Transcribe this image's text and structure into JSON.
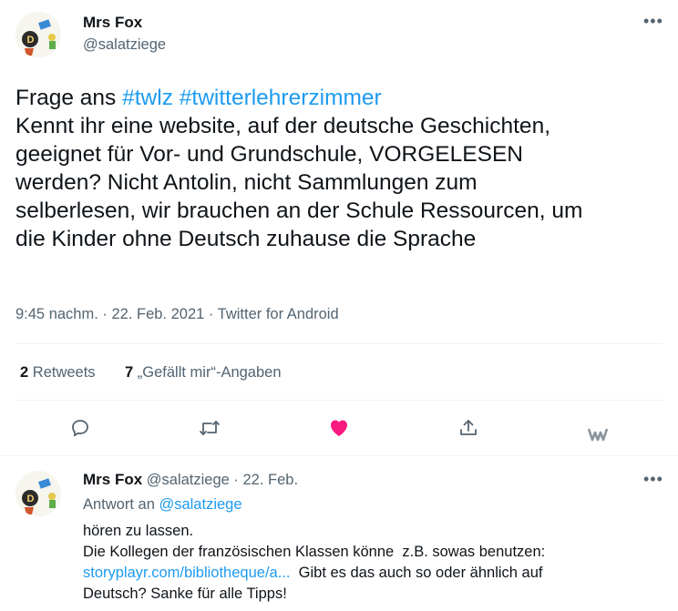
{
  "main_tweet": {
    "author_name": "Mrs Fox",
    "author_handle": "@salatziege",
    "text_intro": "Frage ans ",
    "hashtag1": "#twlz",
    "hashtag2": "#twitterlehrerzimmer",
    "line2": "Kennt ihr eine website, auf der deutsche Geschichten,",
    "line3": "geeignet für Vor- und Grundschule, VORGELESEN",
    "line4": "werden? Nicht Antolin, nicht Sammlungen zum",
    "line5": "selberlesen, wir brauchen an der Schule Ressourcen, um",
    "line6": "die Kinder ohne Deutsch zuhause die Sprache",
    "meta": "9:45 nachm. · 22. Feb. 2021 · Twitter for Android",
    "retweets_count": "2",
    "retweets_label": "Retweets",
    "likes_count": "7",
    "likes_label": "„Gefällt mir“-Angaben"
  },
  "reply": {
    "author_name": "Mrs Fox",
    "author_handle": "@salatziege · 22. Feb.",
    "replying_prefix": "Antwort an ",
    "replying_handle": "@salatziege",
    "line1": "hören zu lassen.",
    "line2": "Die Kollegen der französischen Klassen könne  z.B. sowas benutzen:",
    "link": "storyplayr.com/bibliotheque/a...",
    "line3_rest": "  Gibt es das auch so oder ähnlich auf",
    "line4": "Deutsch? Sanke für alle Tipps!"
  },
  "colors": {
    "accent": "#1d9bf0",
    "like": "#f91880",
    "muted": "#536471"
  },
  "icons": [
    "more-icon",
    "reply-icon",
    "retweet-icon",
    "like-icon",
    "share-icon",
    "extension-icon"
  ]
}
